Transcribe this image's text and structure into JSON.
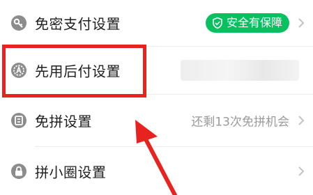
{
  "settings": {
    "items": [
      {
        "label": "免密支付设置",
        "badge": "安全有保障",
        "icon": "key-icon"
      },
      {
        "label": "先用后付设置",
        "value_blurred": true,
        "icon": "a-badge-icon"
      },
      {
        "label": "免拼设置",
        "value": "还剩13次免拼机会",
        "icon": "coupon-icon"
      },
      {
        "label": "拼小圈设置",
        "icon": "lock-icon"
      }
    ]
  },
  "colors": {
    "badge_green": "#07c160",
    "highlight_red": "#e8231f",
    "arrow_red": "#e8231f"
  }
}
